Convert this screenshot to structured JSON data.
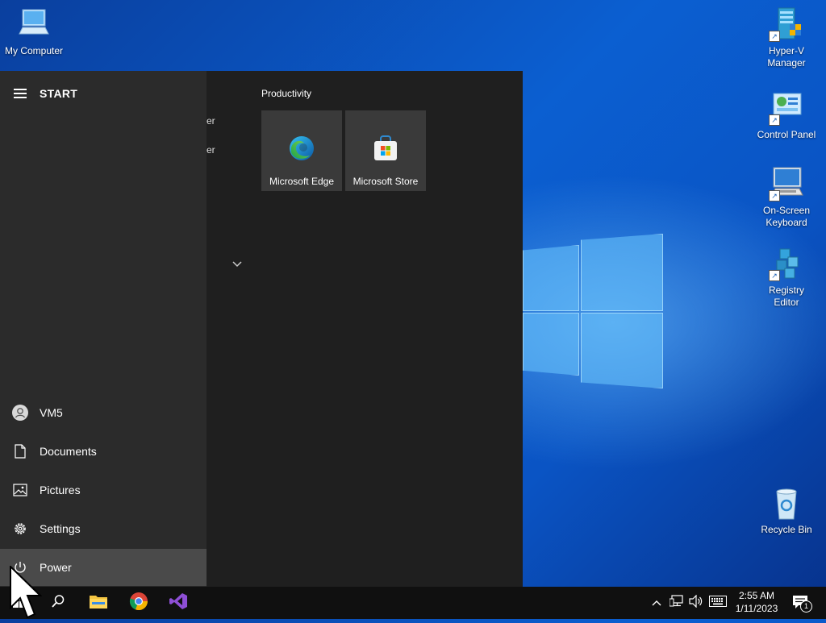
{
  "desktop": {
    "icons": {
      "my_computer": "My Computer",
      "hyperv_line1": "Hyper-V",
      "hyperv_line2": "Manager",
      "control_panel": "Control Panel",
      "osk_line1": "On-Screen",
      "osk_line2": "Keyboard",
      "regedit_line1": "Registry",
      "regedit_line2": "Editor",
      "recycle_bin": "Recycle Bin"
    }
  },
  "start_menu": {
    "header_label": "START",
    "peek_1": "er",
    "peek_2": "er",
    "rail_items": [
      {
        "label": "VM5",
        "icon": "user-icon"
      },
      {
        "label": "Documents",
        "icon": "document-icon"
      },
      {
        "label": "Pictures",
        "icon": "pictures-icon"
      },
      {
        "label": "Settings",
        "icon": "gear-icon"
      },
      {
        "label": "Power",
        "icon": "power-icon"
      }
    ],
    "group_title": "Productivity",
    "tiles": [
      {
        "label": "Microsoft Edge",
        "icon": "edge-icon"
      },
      {
        "label": "Microsoft Store",
        "icon": "store-icon"
      }
    ]
  },
  "taskbar": {
    "clock_time": "2:55 AM",
    "clock_date": "1/11/2023",
    "notification_count": "1",
    "pinned": [
      "search-icon",
      "file-explorer-icon",
      "chrome-icon",
      "visual-studio-icon"
    ],
    "tray": [
      "chevron-up-icon",
      "network-icon",
      "volume-icon",
      "keyboard-icon",
      "action-center-icon"
    ]
  },
  "colors": {
    "accent": "#0b5fd1",
    "menu_bg": "#1f1f1f",
    "rail_bg": "#2b2b2b",
    "tile_bg": "#3a3a3a",
    "taskbar_bg": "#101010"
  }
}
